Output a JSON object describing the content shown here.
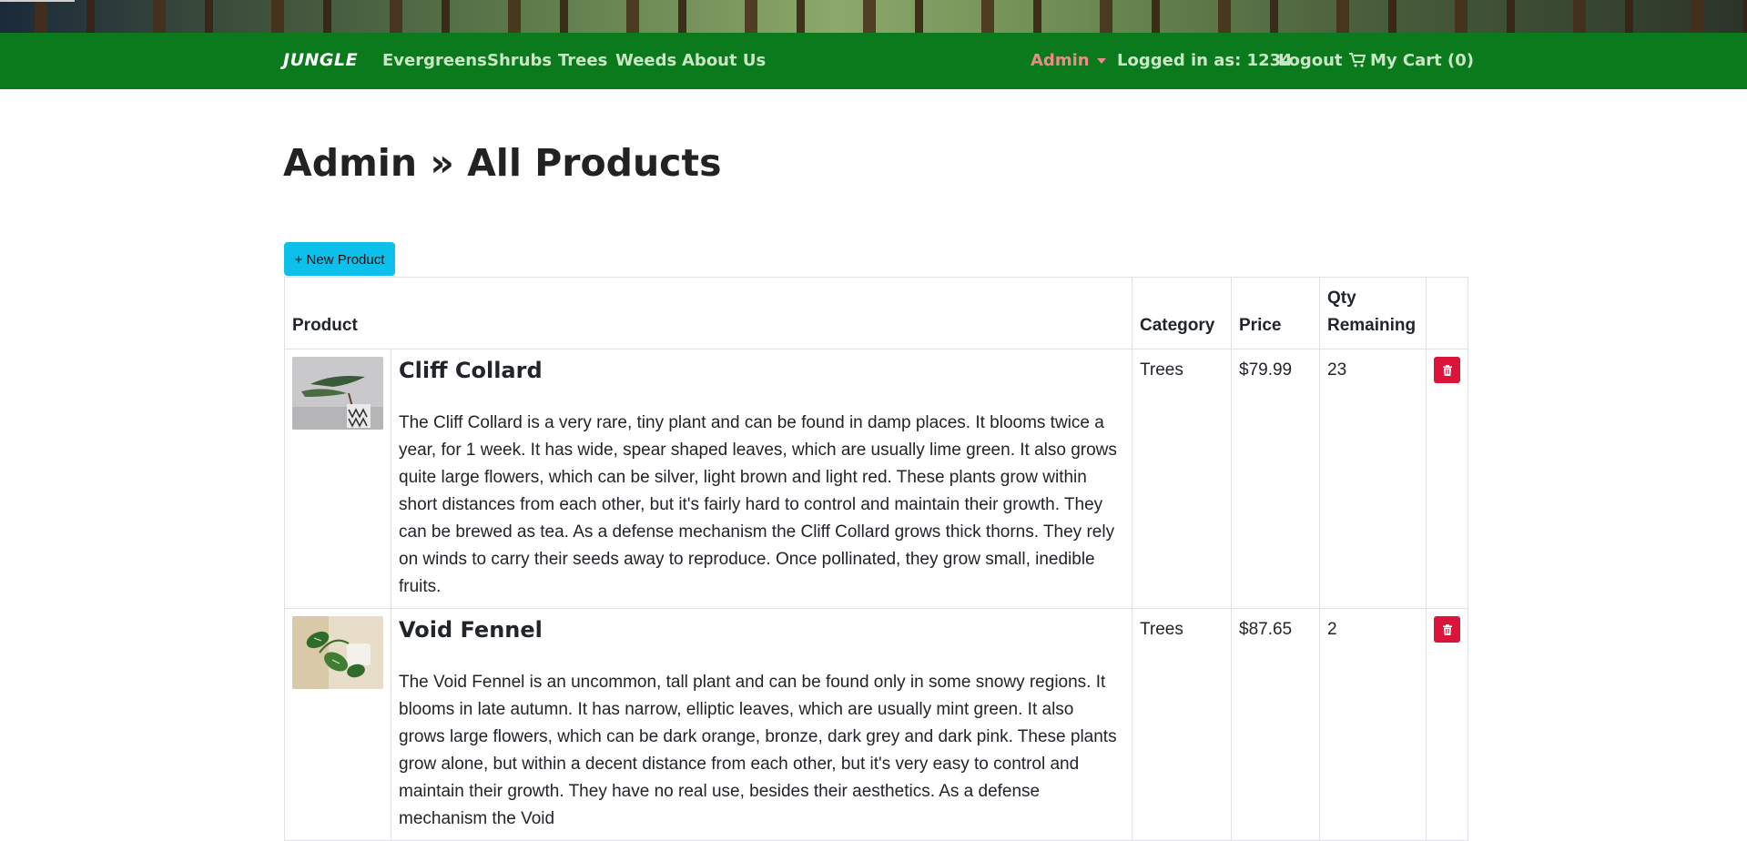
{
  "navbar": {
    "brand": "JUNGLE",
    "links": [
      "Evergreens",
      "Shrubs",
      "Trees",
      "Weeds",
      "About Us"
    ],
    "admin_label": "Admin",
    "logged_in": "Logged in as: 1234",
    "logout": "Logout",
    "cart": "My Cart (0)",
    "colors": {
      "navbar_bg": "#0b7a1c",
      "link": "#c9e6c6",
      "admin": "#f08a8a"
    }
  },
  "page": {
    "title": "Admin » All Products",
    "new_button": "+ New Product"
  },
  "table": {
    "headers": {
      "product": "Product",
      "category": "Category",
      "price": "Price",
      "qty": "Qty Remaining"
    },
    "rows": [
      {
        "name": "Cliff Collard",
        "description": "The Cliff Collard is a very rare, tiny plant and can be found in damp places. It blooms twice a year, for 1 week. It has wide, spear shaped leaves, which are usually lime green. It also grows quite large flowers, which can be silver, light brown and light red. These plants grow within short distances from each other, but it's fairly hard to control and maintain their growth. They can be brewed as tea. As a defense mechanism the Cliff Collard grows thick thorns. They rely on winds to carry their seeds away to reproduce. Once pollinated, they grow small, inedible fruits.",
        "category": "Trees",
        "price": "$79.99",
        "qty": "23",
        "image_icon": "bonsai-plant-image"
      },
      {
        "name": "Void Fennel",
        "description": "The Void Fennel is an uncommon, tall plant and can be found only in some snowy regions. It blooms in late autumn. It has narrow, elliptic leaves, which are usually mint green. It also grows large flowers, which can be dark orange, bronze, dark grey and dark pink. These plants grow alone, but within a decent distance from each other, but it's very easy to control and maintain their growth. They have no real use, besides their aesthetics. As a defense mechanism the Void",
        "category": "Trees",
        "price": "$87.65",
        "qty": "2",
        "image_icon": "pothos-plant-image"
      }
    ],
    "delete_icon": "trash-icon",
    "delete_color": "#dc143c"
  }
}
